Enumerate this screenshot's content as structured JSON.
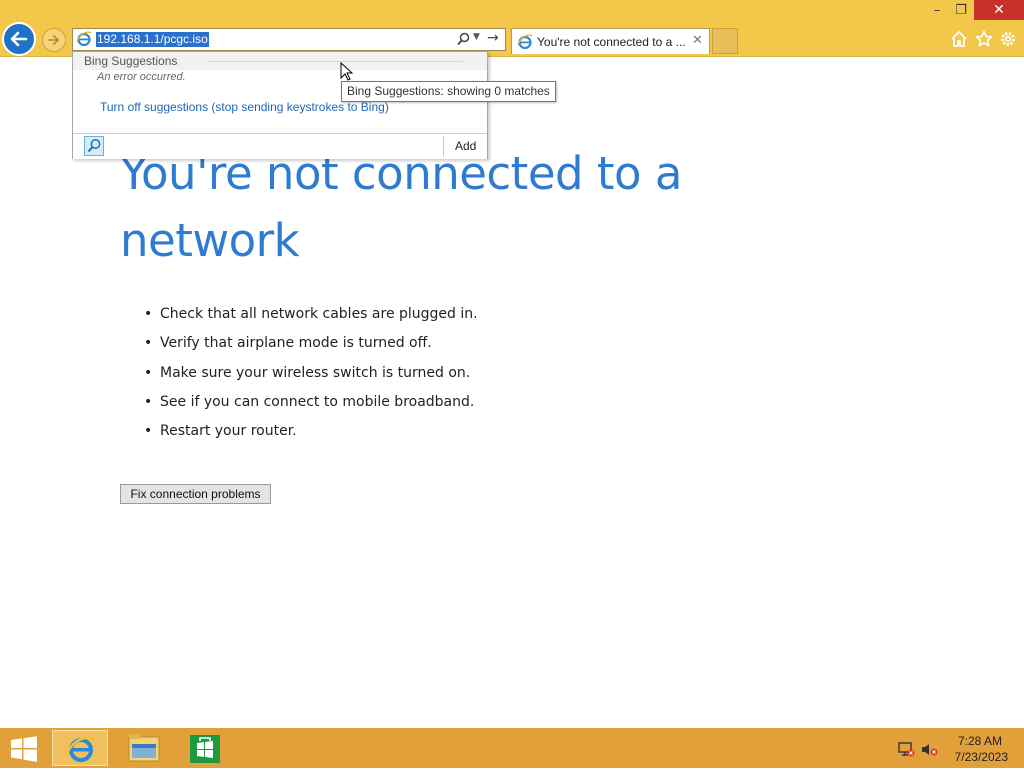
{
  "window": {
    "controls": {
      "minimize": "–",
      "restore": "❐",
      "close": "✕"
    }
  },
  "address_bar": {
    "url": "192.168.1.1/pcgc.iso",
    "go_glyph": "→",
    "dropdown_glyph": "▼"
  },
  "tab": {
    "title": "You're not connected to a ...",
    "close_glyph": "✕"
  },
  "suggestions": {
    "header": "Bing Suggestions",
    "error": "An error occurred.",
    "turn_off_link": "Turn off suggestions (stop sending keystrokes to Bing)",
    "add_label": "Add"
  },
  "tooltip": "Bing Suggestions: showing 0 matches",
  "page": {
    "heading": "You're not connected to a network",
    "tips": [
      "Check that all network cables are plugged in.",
      "Verify that airplane mode is turned off.",
      "Make sure your wireless switch is turned on.",
      "See if you can connect to mobile broadband.",
      "Restart your router."
    ],
    "fix_button": "Fix connection problems"
  },
  "taskbar": {
    "time": "7:28 AM",
    "date": "7/23/2023",
    "apps": [
      "internet-explorer",
      "file-explorer",
      "store"
    ]
  },
  "colors": {
    "chrome_bg": "#f3c74a",
    "taskbar_bg": "#e1a03a",
    "heading_blue": "#2f7bd1",
    "link_blue": "#2067b8",
    "close_red": "#c7312a"
  }
}
